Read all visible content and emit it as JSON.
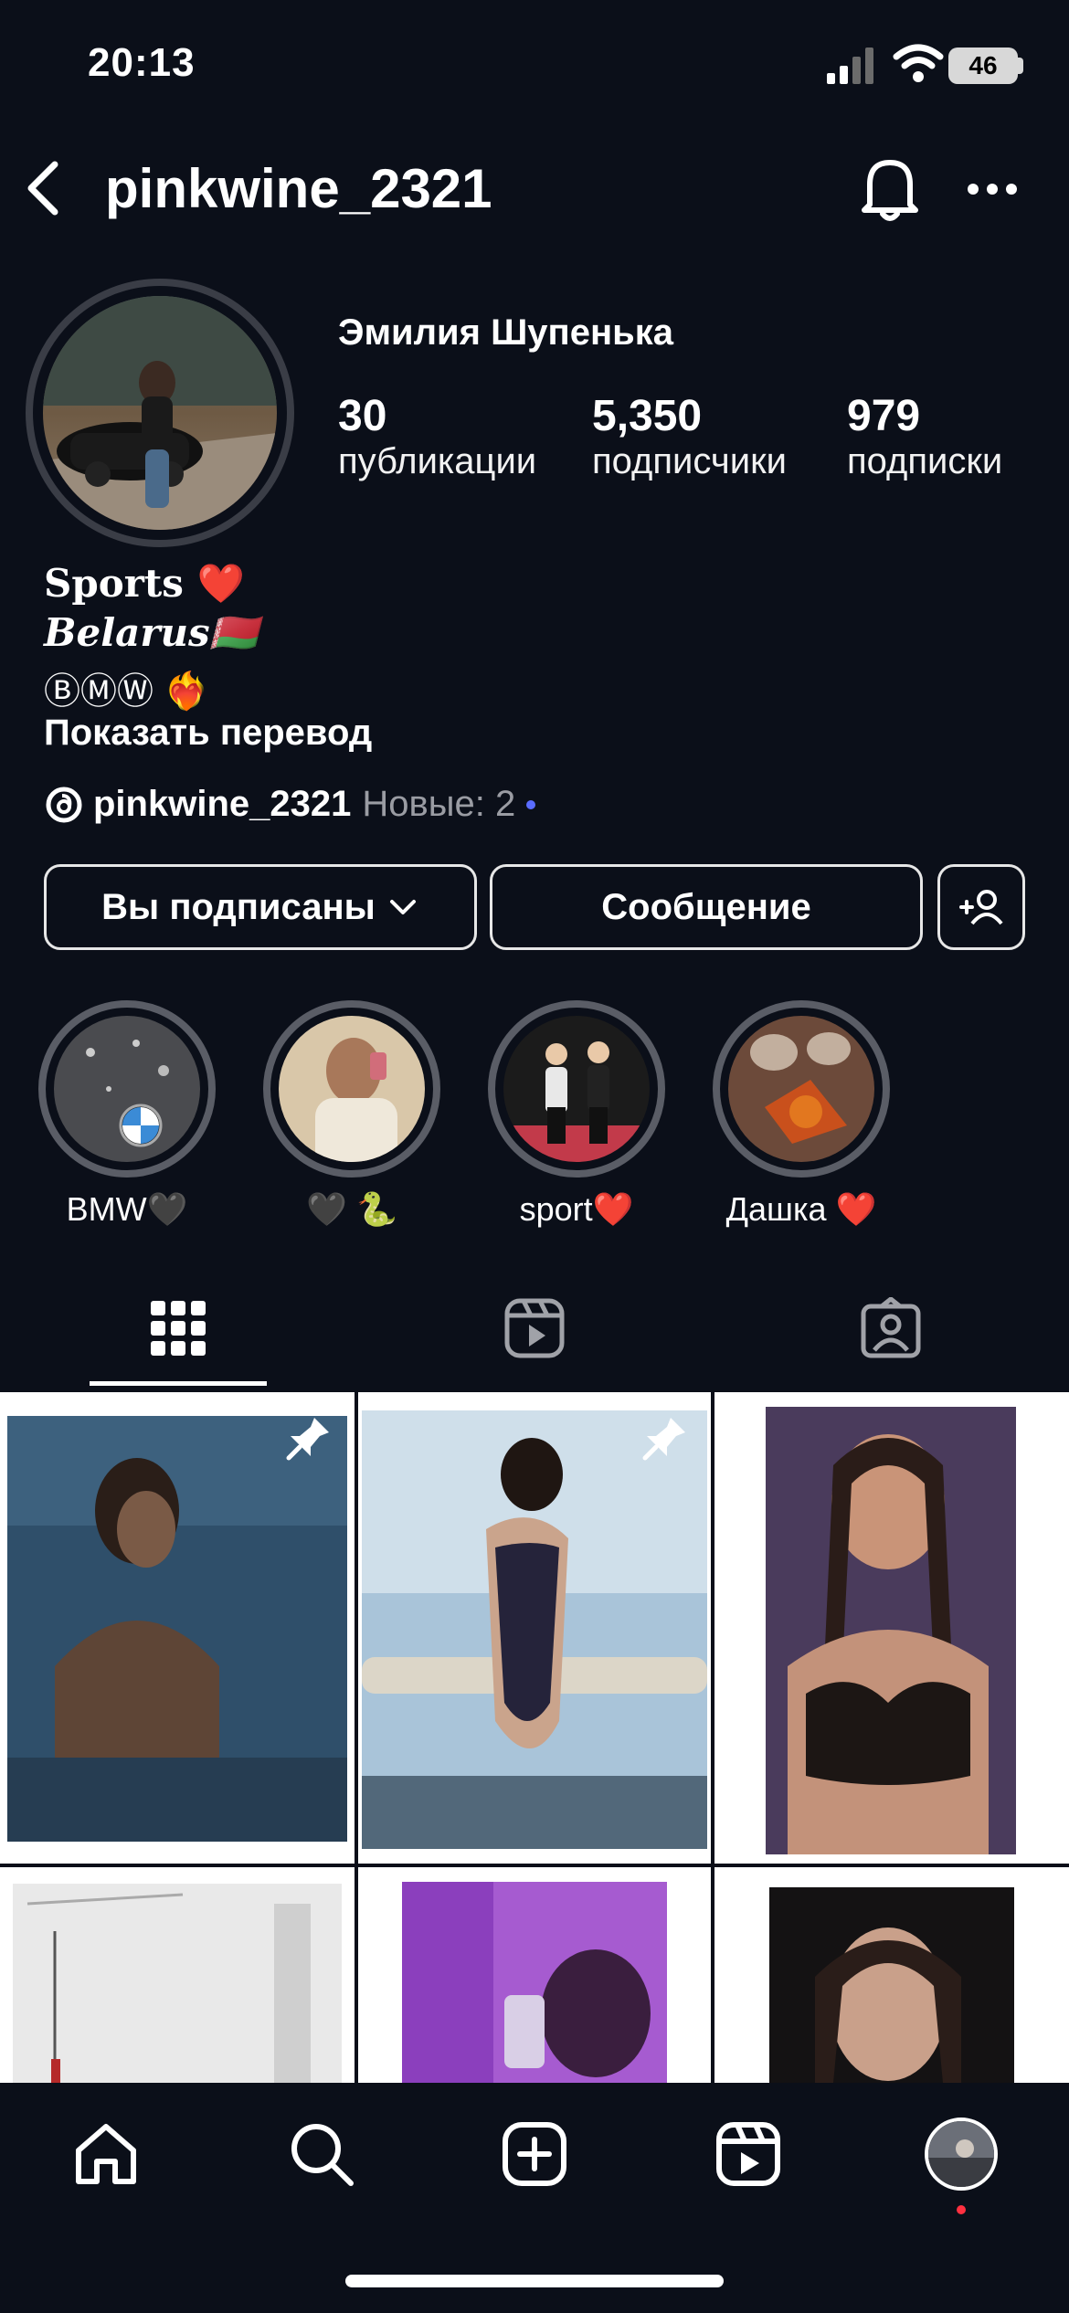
{
  "status_bar": {
    "time": "20:13",
    "battery": "46"
  },
  "header": {
    "username": "pinkwine_2321"
  },
  "profile": {
    "full_name": "Эмилия Шупенька",
    "stats": [
      {
        "value": "30",
        "label": "публикации"
      },
      {
        "value": "5,350",
        "label": "подписчики"
      },
      {
        "value": "979",
        "label": "подписки"
      }
    ],
    "bio": {
      "line1": "Sports ❤️",
      "line2": "Belarus🇧🇾",
      "line3": "ⒷⓂⓌ ❤️‍🔥",
      "show_translation": "Показать перевод"
    },
    "threads": {
      "handle": "pinkwine_2321",
      "new_label": "Новые: 2"
    }
  },
  "actions": {
    "following_label": "Вы подписаны",
    "message_label": "Сообщение"
  },
  "highlights": [
    {
      "label": "BMW🖤"
    },
    {
      "label": "🖤 🐍"
    },
    {
      "label": "sport❤️"
    },
    {
      "label": "Дашка ❤️"
    }
  ],
  "colors": {
    "background": "#0b0f19",
    "accent_dot": "#5a6cff",
    "notification_dot": "#ff3040"
  }
}
